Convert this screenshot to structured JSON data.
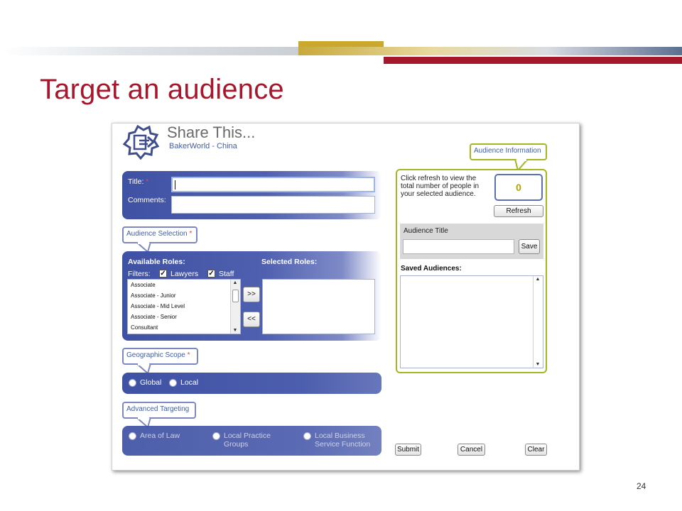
{
  "slide": {
    "title": "Target an audience",
    "page_number": "24"
  },
  "app": {
    "title": "Share This...",
    "subtitle": "BakerWorld - China"
  },
  "form": {
    "title_label": "Title:",
    "required_mark": "*",
    "comments_label": "Comments:",
    "title_value": "",
    "comments_value": ""
  },
  "audience_selection": {
    "callout": "Audience Selection",
    "available_label": "Available Roles:",
    "selected_label": "Selected Roles:",
    "filters_label": "Filters:",
    "filters": [
      {
        "label": "Lawyers",
        "checked": true
      },
      {
        "label": "Staff",
        "checked": true
      }
    ],
    "available_roles": [
      "Associate",
      "Associate - Junior",
      "Associate - Mid Level",
      "Associate - Senior",
      "Consultant"
    ],
    "selected_roles": [],
    "add_button": ">>",
    "remove_button": "<<"
  },
  "geographic_scope": {
    "callout": "Geographic Scope",
    "options": [
      "Global",
      "Local"
    ]
  },
  "advanced_targeting": {
    "callout": "Advanced Targeting",
    "options": [
      "Area of Law",
      "Local Practice Groups",
      "Local Business Service Function"
    ],
    "option_lines": [
      [
        "Area of Law"
      ],
      [
        "Local Practice",
        "Groups"
      ],
      [
        "Local Business",
        "Service Function"
      ]
    ]
  },
  "audience_info": {
    "callout": "Audience Information",
    "description_lines": [
      "Click refresh to view the",
      "total number of people in",
      "your selected audience."
    ],
    "count": "0",
    "refresh_button": "Refresh",
    "audience_title_label": "Audience Title",
    "audience_title_value": "",
    "save_button": "Save",
    "saved_label": "Saved Audiences:"
  },
  "footer_buttons": {
    "submit": "Submit",
    "cancel": "Cancel",
    "clear": "Clear"
  },
  "colors": {
    "accent_red": "#a5182c",
    "panel_blue": "#3f51a3",
    "info_green": "#a3b820"
  },
  "icons": [
    "share-logo-icon",
    "checkmark-icon",
    "scroll-up-arrow-icon",
    "scroll-down-arrow-icon"
  ]
}
